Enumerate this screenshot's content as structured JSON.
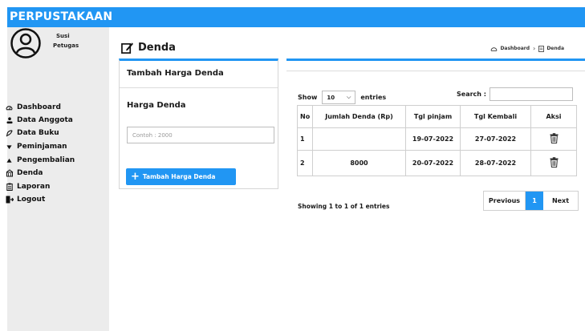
{
  "app": {
    "brand": "PERPUSTAKAAN"
  },
  "user": {
    "name": "Susi",
    "role": "Petugas"
  },
  "sidebar": {
    "items": [
      {
        "label": "Dashboard",
        "icon": "dashboard-icon"
      },
      {
        "label": "Data Anggota",
        "icon": "person-icon"
      },
      {
        "label": "Data Buku",
        "icon": "feather-icon"
      },
      {
        "label": "Peminjaman",
        "icon": "triangle-down-icon"
      },
      {
        "label": "Pengembalian",
        "icon": "triangle-up-icon"
      },
      {
        "label": "Denda",
        "icon": "building-icon"
      },
      {
        "label": "Laporan",
        "icon": "clipboard-icon"
      },
      {
        "label": "Logout",
        "icon": "logout-icon"
      }
    ]
  },
  "page": {
    "title": "Denda",
    "breadcrumb": {
      "home": "Dashboard",
      "current": "Denda"
    }
  },
  "form": {
    "heading": "Tambah Harga Denda",
    "label": "Harga Denda",
    "placeholder": "Contoh : 2000",
    "value": "",
    "submit_label": "Tambah Harga Denda"
  },
  "table": {
    "show_label": "Show",
    "page_size": "10",
    "entries_label": "entries",
    "search_label": "Search :",
    "search_value": "",
    "columns": [
      "No",
      "Jumlah Denda (Rp)",
      "Tgl pinjam",
      "Tgl Kembali",
      "Aksi"
    ],
    "rows": [
      {
        "no": "1",
        "jumlah": "",
        "tgl_pinjam": "19-07-2022",
        "tgl_kembali": "27-07-2022"
      },
      {
        "no": "2",
        "jumlah": "8000",
        "tgl_pinjam": "20-07-2022",
        "tgl_kembali": "28-07-2022"
      }
    ],
    "info": "Showing 1 to 1 of 1 entries",
    "pagination": {
      "prev": "Previous",
      "current": "1",
      "next": "Next"
    }
  },
  "colors": {
    "accent": "#2196f3",
    "sidebar": "#ececec"
  }
}
